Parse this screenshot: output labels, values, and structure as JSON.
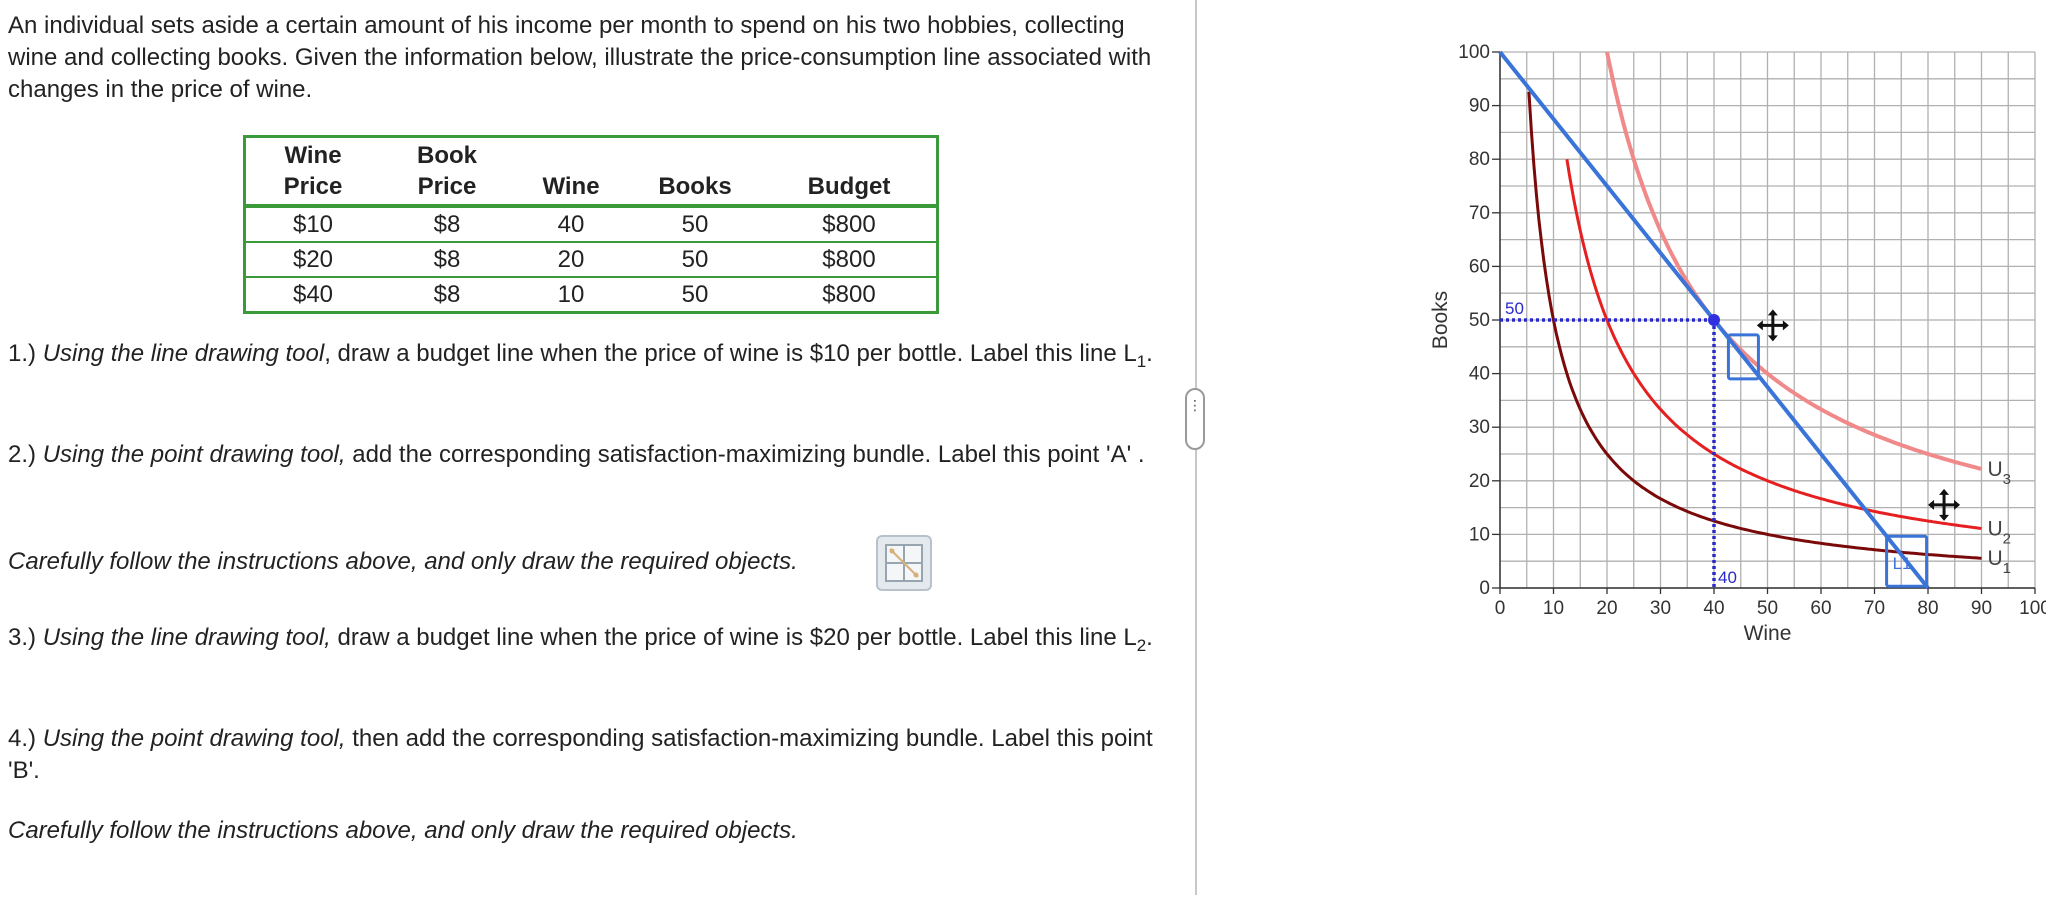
{
  "intro": "An individual sets aside a certain amount of his income per month to spend on his two hobbies, collecting wine and collecting books. Given the information below, illustrate the price-consumption line associated with changes in the price of wine.",
  "table": {
    "headers": [
      {
        "line1": "Wine",
        "line2": "Price"
      },
      {
        "line1": "Book",
        "line2": "Price"
      },
      {
        "line1": "",
        "line2": "Wine"
      },
      {
        "line1": "",
        "line2": "Books"
      },
      {
        "line1": "",
        "line2": "Budget"
      }
    ],
    "rows": [
      [
        "$10",
        "$8",
        "40",
        "50",
        "$800"
      ],
      [
        "$20",
        "$8",
        "20",
        "50",
        "$800"
      ],
      [
        "$40",
        "$8",
        "10",
        "50",
        "$800"
      ]
    ]
  },
  "questions": {
    "q1": {
      "num": "1.) ",
      "em": "Using the line drawing tool",
      "rest": ", draw a budget line when the price of wine is $10 per bottle. Label this line L",
      "sub": "1",
      "end": "."
    },
    "q2": {
      "num": "2.) ",
      "em": "Using the point drawing tool,",
      "rest": " add the corresponding satisfaction-maximizing bundle. Label this point 'A' ."
    },
    "note1": "Carefully follow the instructions above, and only draw the required objects.",
    "q3": {
      "num": "3.) ",
      "em": "Using the line drawing tool,",
      "rest": " draw a budget line when the price of wine is $20 per bottle. Label this line L",
      "sub": "2",
      "end": "."
    },
    "q4": {
      "num": "4.) ",
      "em": "Using the point drawing tool,",
      "rest": " then add the corresponding satisfaction-maximizing bundle. Label this point 'B'."
    },
    "note2": "Carefully follow the instructions above, and only draw the required objects."
  },
  "divider_handle": "⋮",
  "graph": {
    "x_axis_label": "Wine",
    "y_axis_label": "Books",
    "x_ticks": [
      "0",
      "10",
      "20",
      "30",
      "40",
      "50",
      "60",
      "70",
      "80",
      "90",
      "100"
    ],
    "y_ticks": [
      "0",
      "10",
      "20",
      "30",
      "40",
      "50",
      "60",
      "70",
      "80",
      "90",
      "100"
    ],
    "x_range": [
      0,
      100
    ],
    "y_range": [
      0,
      100
    ],
    "grid_step": 5,
    "curve_labels": [
      {
        "main": "U",
        "sub": "3"
      },
      {
        "main": "U",
        "sub": "2"
      },
      {
        "main": "U",
        "sub": "1"
      }
    ],
    "curves": [
      {
        "k": 2000,
        "color": "#f08a8a",
        "x_from": 20,
        "x_to": 90,
        "label_idx": 0
      },
      {
        "k": 1000,
        "color": "#e62020",
        "x_from": 12.5,
        "x_to": 90,
        "label_idx": 1
      },
      {
        "k": 500,
        "color": "#7a0a0a",
        "x_from": 5.4,
        "x_to": 90,
        "label_idx": 2
      }
    ],
    "budget_line": {
      "from": [
        0,
        100
      ],
      "to": [
        80,
        0
      ],
      "color": "#3a74d8",
      "label": "L1"
    },
    "point_A": {
      "x": 40,
      "y": 50,
      "color": "#3030e0"
    },
    "guide_labels": {
      "x": "40",
      "y": "50"
    },
    "colors": {
      "grid": "#b0b0b0",
      "axis": "#333333",
      "guide": "#2a2ac8",
      "tick_text": "#333333"
    }
  }
}
